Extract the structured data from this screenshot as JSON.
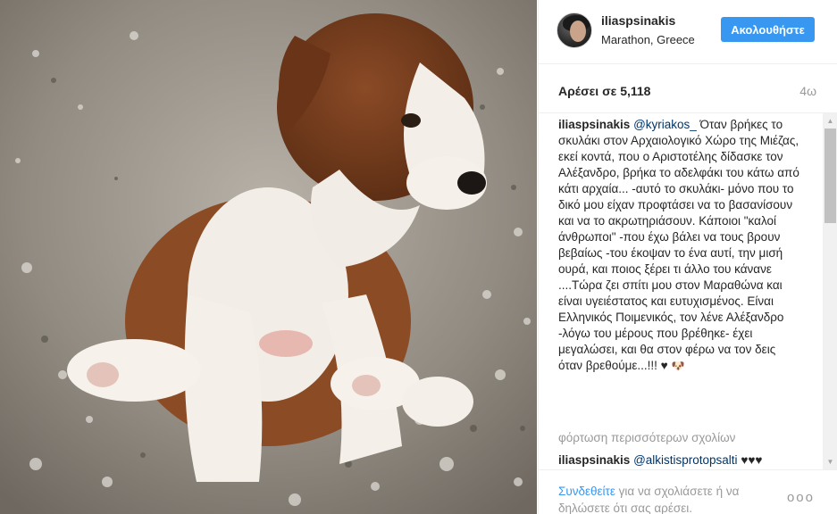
{
  "header": {
    "username": "iliaspsinakis",
    "location": "Marathon, Greece",
    "follow_label": "Ακολουθήστε"
  },
  "stats": {
    "likes": "Αρέσει σε 5,118",
    "time_ago": "4ω"
  },
  "caption": {
    "user": "iliaspsinakis",
    "mention": "@kyriakos_",
    "text": " Όταν βρήκες το σκυλάκι στον Αρχαιολογικό Χώρο της Μιέζας, εκεί κοντά, που ο Αριστοτέλης δίδασκε τον Αλέξανδρο, βρήκα το αδελφάκι του κάτω από κάτι αρχαία... -αυτό το σκυλάκι- μόνο που το δικό μου είχαν προφτάσει να το βασανίσουν και να το ακρωτηριάσουν. Κάποιοι \"καλοί άνθρωποι\" -που έχω βάλει να τους βρουν βεβαίως -του έκοψαν το ένα αυτί, την μισή ουρά, και ποιος ξέρει τι άλλο του κάνανε ....Τώρα ζει σπίτι μου στον Μαραθώνα και είναι υγειέστατος και ευτυχισμένος. Είναι Ελληνικός Ποιμενικός, τον λένε Αλέξανδρο -λόγω του μέρους που βρέθηκε- έχει μεγαλώσει, και θα στον φέρω να τον δεις όταν βρεθούμε...!!! ♥",
    "emoji": "🐶"
  },
  "load_more": "φόρτωση περισσότερων σχολίων",
  "comment": {
    "user": "iliaspsinakis",
    "mention": "@alkistisprotopsalti",
    "text": " ♥♥♥"
  },
  "footer": {
    "login_link": "Συνδεθείτε",
    "prompt": " για να σχολιάσετε ή να δηλώσετε ότι σας αρέσει.",
    "more_label": "ooo"
  },
  "icons": {
    "more": "more-options-icon",
    "scroll_up": "scroll-up-arrow-icon",
    "scroll_down": "scroll-down-arrow-icon"
  },
  "colors": {
    "follow_button": "#3897f0",
    "link": "#3897f0",
    "mention": "#003569",
    "muted_text": "#999999"
  }
}
